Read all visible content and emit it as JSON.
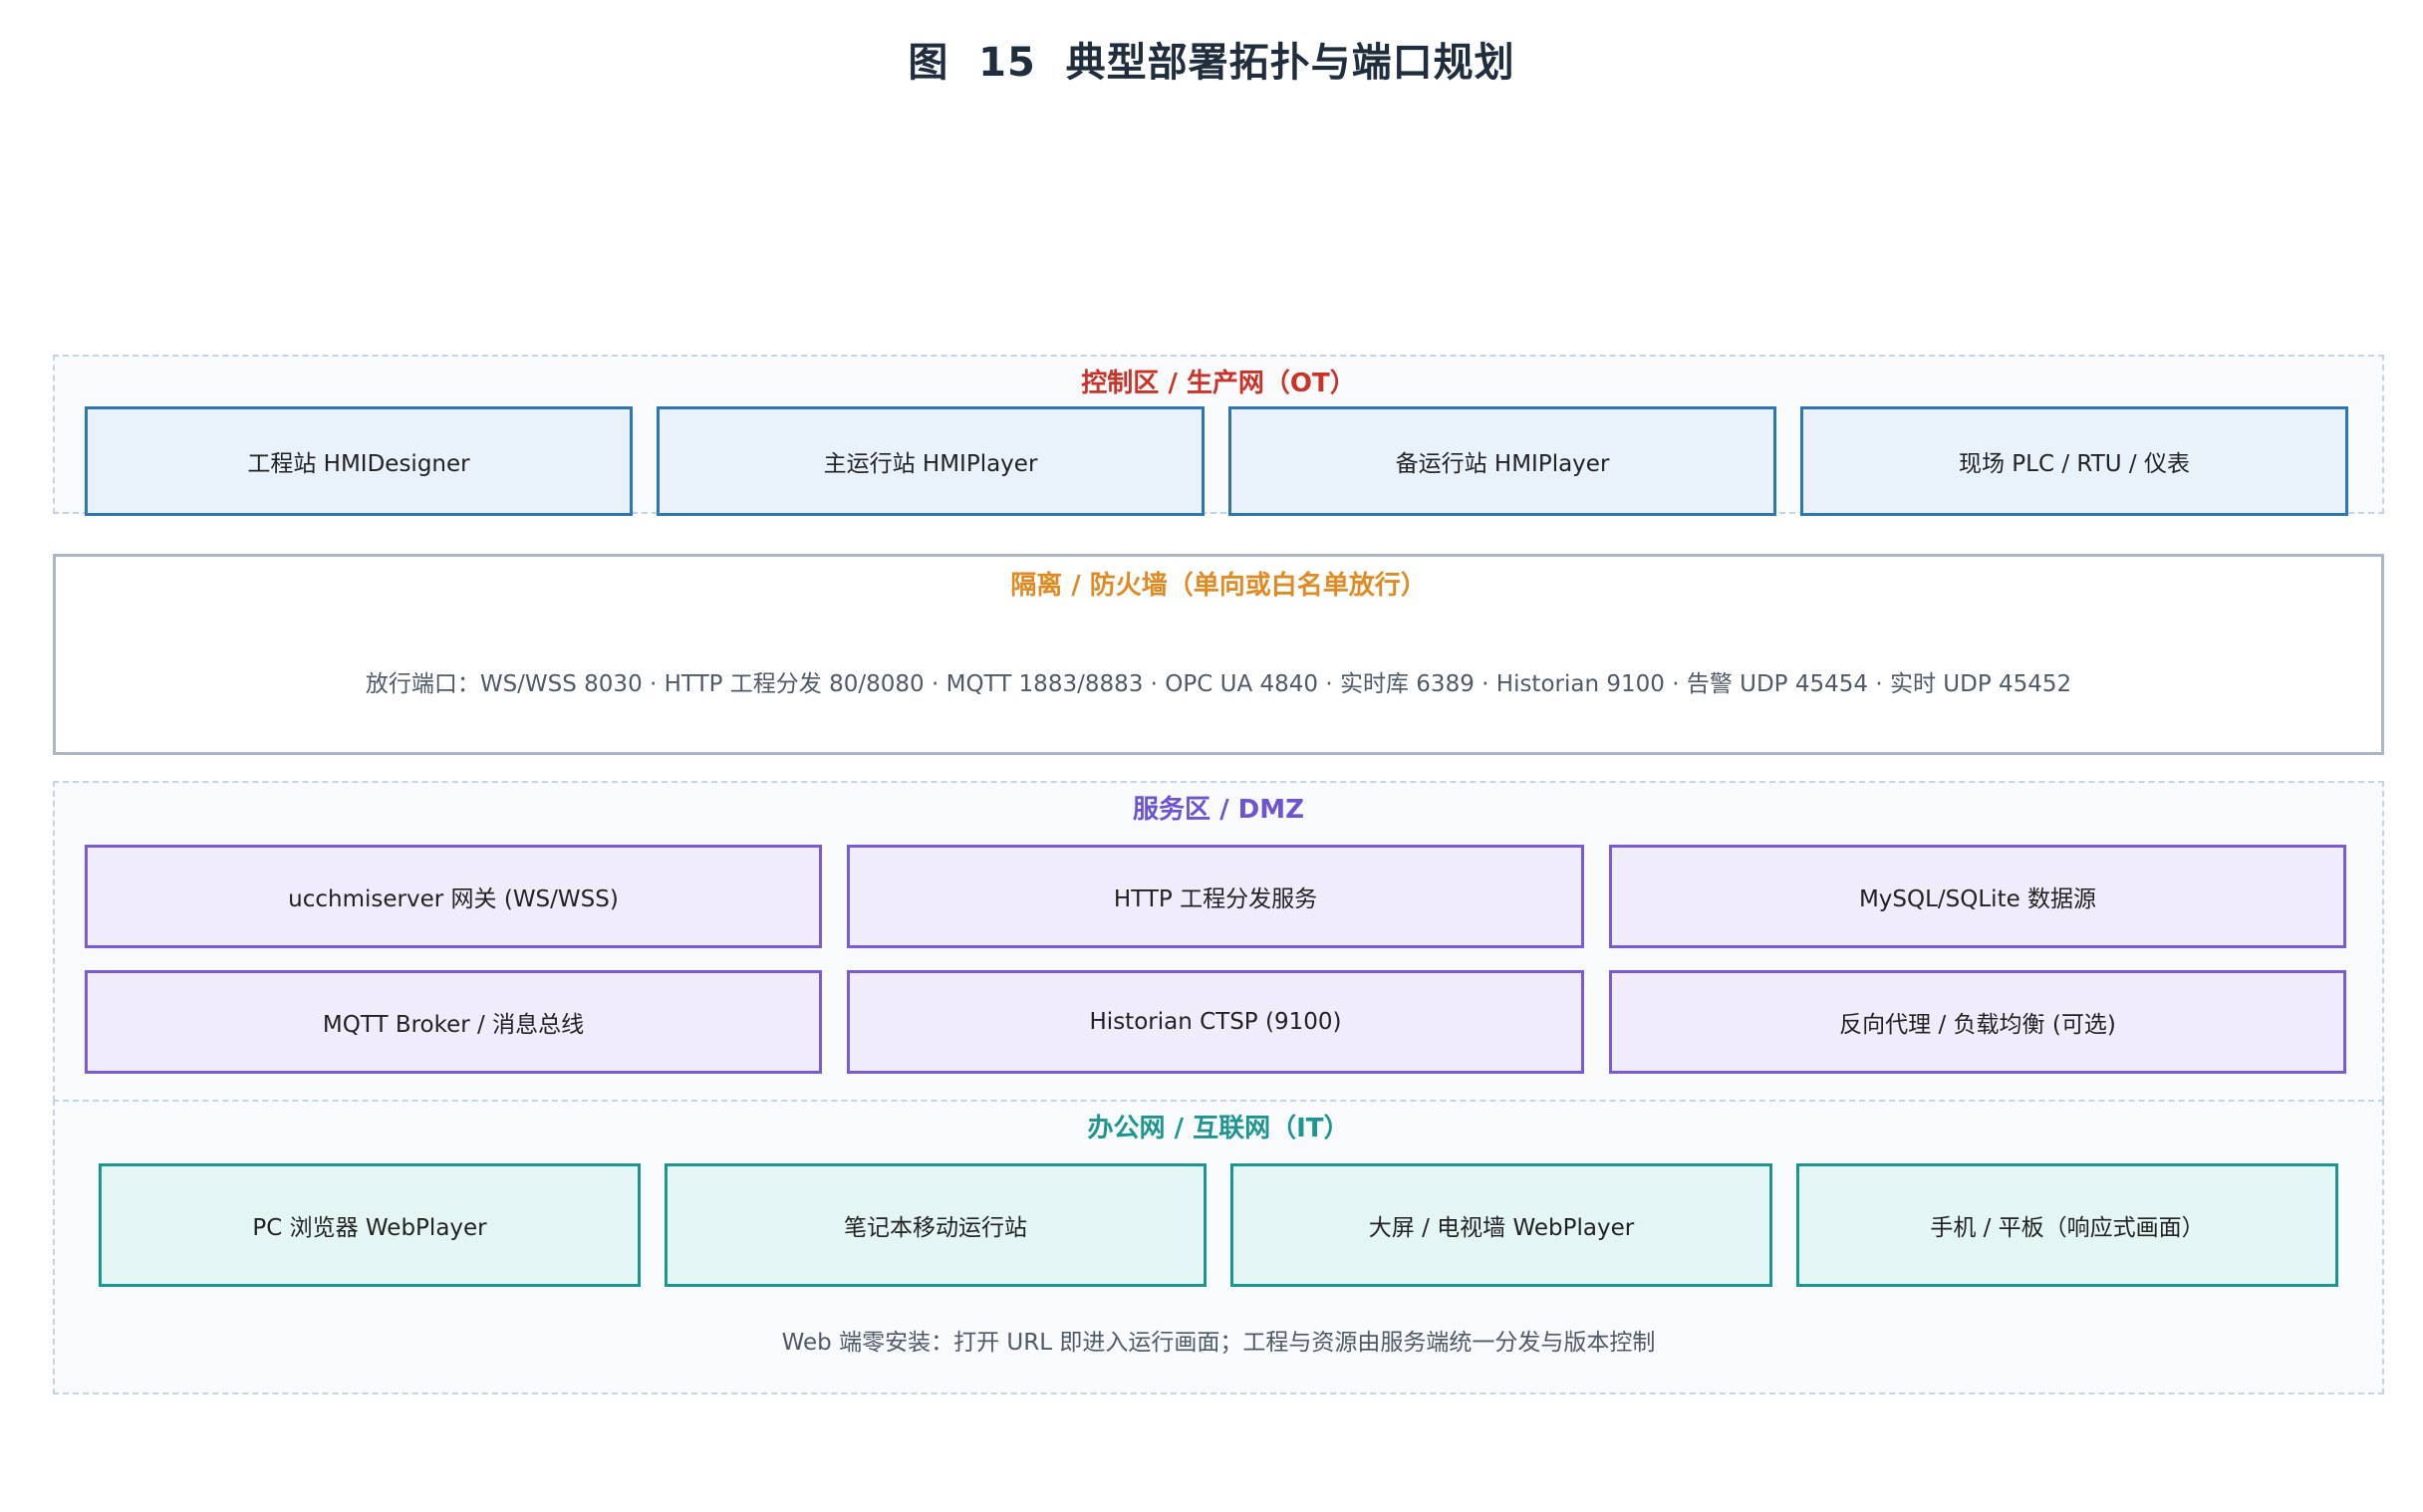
{
  "title": "图  15  典型部署拓扑与端口规划",
  "colors": {
    "ot": "#c9342a",
    "firewall": "#e08a23",
    "dmz": "#6e54d1",
    "it": "#1f9590"
  },
  "zones": {
    "ot": {
      "title": "控制区 / 生产网（OT）",
      "boxes": [
        "工程站 HMIDesigner",
        "主运行站 HMIPlayer",
        "备运行站 HMIPlayer",
        "现场 PLC / RTU / 仪表"
      ]
    },
    "firewall": {
      "title": "隔离 / 防火墙（单向或白名单放行）",
      "ports": "放行端口：WS/WSS 8030 · HTTP 工程分发 80/8080 · MQTT 1883/8883 · OPC UA 4840 · 实时库 6389 · Historian 9100 · 告警 UDP 45454 · 实时 UDP 45452"
    },
    "dmz": {
      "title": "服务区 / DMZ",
      "boxes": [
        "ucchmiserver 网关 (WS/WSS)",
        "HTTP 工程分发服务",
        "MySQL/SQLite 数据源",
        "MQTT Broker / 消息总线",
        "Historian CTSP (9100)",
        "反向代理 / 负载均衡 (可选)"
      ]
    },
    "it": {
      "title": "办公网 / 互联网（IT）",
      "boxes": [
        "PC 浏览器 WebPlayer",
        "笔记本移动运行站",
        "大屏 / 电视墙 WebPlayer",
        "手机 / 平板（响应式画面）"
      ],
      "note": "Web 端零安装：打开 URL 即进入运行画面；工程与资源由服务端统一分发与版本控制"
    }
  }
}
